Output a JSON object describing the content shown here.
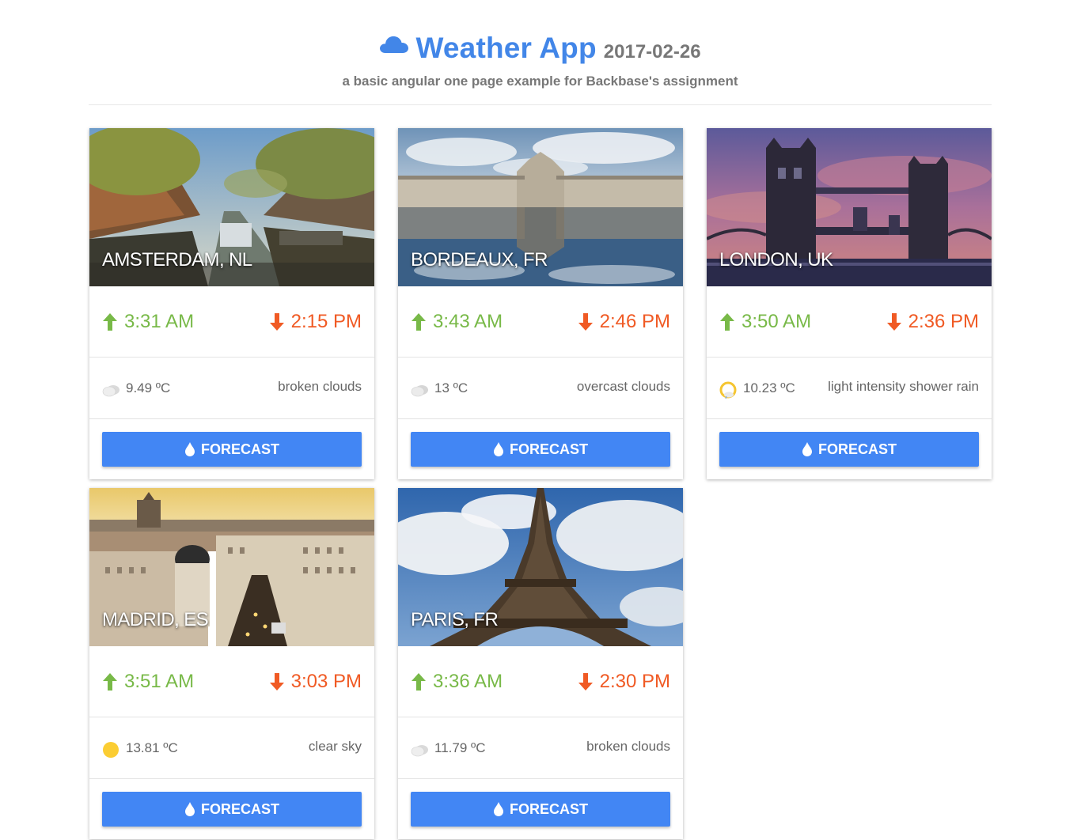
{
  "header": {
    "title": "Weather App",
    "date": "2017-02-26",
    "subtitle": "a basic angular one page example for Backbase's assignment",
    "icon": "cloud-icon"
  },
  "colors": {
    "accent": "#4286e8",
    "sunrise": "#78b948",
    "sunset": "#f05a24",
    "button": "#4286f4"
  },
  "forecast_label": "FORECAST",
  "cities": [
    {
      "name": "AMSTERDAM, NL",
      "sunrise": "3:31 AM",
      "sunset": "2:15 PM",
      "temp": "9.49 ºC",
      "description": "broken clouds",
      "weather_icon": "broken-clouds-icon"
    },
    {
      "name": "BORDEAUX, FR",
      "sunrise": "3:43 AM",
      "sunset": "2:46 PM",
      "temp": "13 ºC",
      "description": "overcast clouds",
      "weather_icon": "overcast-clouds-icon"
    },
    {
      "name": "LONDON, UK",
      "sunrise": "3:50 AM",
      "sunset": "2:36 PM",
      "temp": "10.23 ºC",
      "description": "light intensity shower rain",
      "weather_icon": "shower-rain-icon"
    },
    {
      "name": "MADRID, ES",
      "sunrise": "3:51 AM",
      "sunset": "3:03 PM",
      "temp": "13.81 ºC",
      "description": "clear sky",
      "weather_icon": "clear-sky-icon"
    },
    {
      "name": "PARIS, FR",
      "sunrise": "3:36 AM",
      "sunset": "2:30 PM",
      "temp": "11.79 ºC",
      "description": "broken clouds",
      "weather_icon": "broken-clouds-icon"
    }
  ]
}
